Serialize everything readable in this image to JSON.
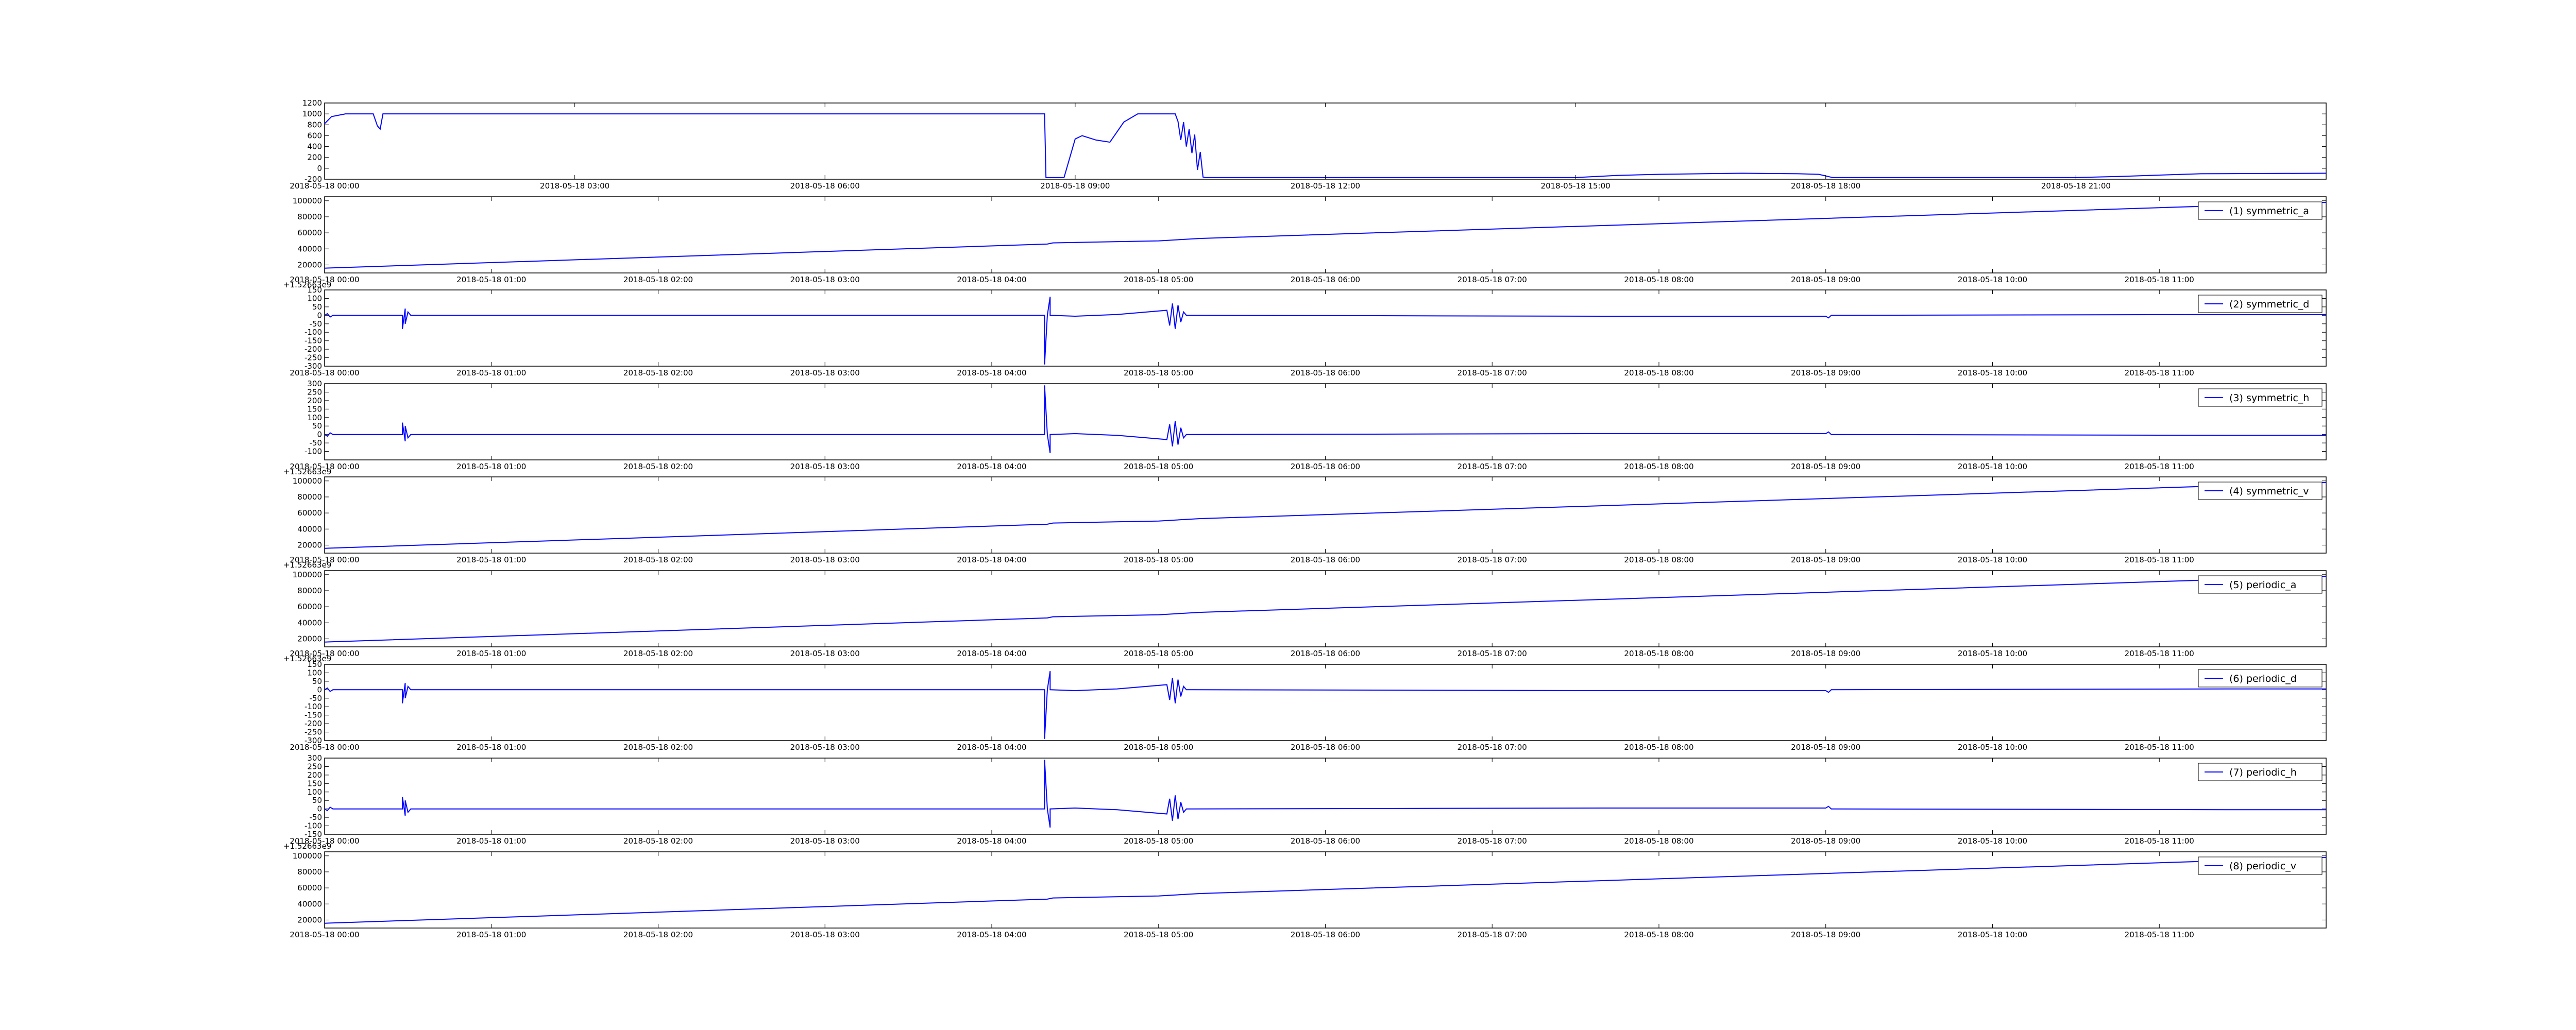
{
  "figure": {
    "line_color": "#0000ff",
    "background": "#ffffff"
  },
  "chart_data": [
    {
      "type": "line",
      "x_range": [
        "2018-05-18 00:00",
        "2018-05-19 00:00"
      ],
      "x_ticks": [
        "2018-05-18 00:00",
        "2018-05-18 03:00",
        "2018-05-18 06:00",
        "2018-05-18 09:00",
        "2018-05-18 12:00",
        "2018-05-18 15:00",
        "2018-05-18 18:00",
        "2018-05-18 21:00"
      ],
      "ylim": [
        -200,
        1200
      ],
      "y_ticks": [
        -200,
        0,
        200,
        400,
        600,
        800,
        1000,
        1200
      ],
      "offset_text": "",
      "legend": "",
      "series": [
        {
          "x": [
            "2018-05-18 00:00",
            "2018-05-18 00:05",
            "2018-05-18 00:15",
            "2018-05-18 00:30",
            "2018-05-18 00:35",
            "2018-05-18 00:38",
            "2018-05-18 00:40",
            "2018-05-18 00:42",
            "2018-05-18 01:00",
            "2018-05-18 04:00",
            "2018-05-18 07:00",
            "2018-05-18 08:38",
            "2018-05-18 08:39",
            "2018-05-18 08:50",
            "2018-05-18 08:52",
            "2018-05-18 09:00",
            "2018-05-18 09:05",
            "2018-05-18 09:15",
            "2018-05-18 09:25",
            "2018-05-18 09:35",
            "2018-05-18 09:45",
            "2018-05-18 10:10",
            "2018-05-18 10:12",
            "2018-05-18 10:14",
            "2018-05-18 10:16",
            "2018-05-18 10:18",
            "2018-05-18 10:20",
            "2018-05-18 10:22",
            "2018-05-18 10:24",
            "2018-05-18 10:26",
            "2018-05-18 10:28",
            "2018-05-18 10:30",
            "2018-05-18 10:32",
            "2018-05-18 10:34",
            "2018-05-18 12:00",
            "2018-05-18 15:00",
            "2018-05-18 15:30",
            "2018-05-18 16:00",
            "2018-05-18 17:00",
            "2018-05-18 17:40",
            "2018-05-18 17:55",
            "2018-05-18 18:05",
            "2018-05-18 18:15",
            "2018-05-18 21:00",
            "2018-05-18 21:30",
            "2018-05-18 22:30",
            "2018-05-19 00:00"
          ],
          "y": [
            820,
            950,
            1000,
            1000,
            1000,
            780,
            720,
            1000,
            1000,
            1000,
            1000,
            1000,
            -170,
            -170,
            -170,
            540,
            600,
            520,
            480,
            850,
            1000,
            1000,
            1000,
            860,
            520,
            850,
            400,
            720,
            280,
            620,
            -30,
            300,
            -160,
            -170,
            -170,
            -170,
            -130,
            -110,
            -90,
            -100,
            -110,
            -170,
            -170,
            -170,
            -150,
            -100,
            -90
          ]
        }
      ]
    },
    {
      "type": "line",
      "x_range": [
        "2018-05-18 00:00",
        "2018-05-18 12:00"
      ],
      "x_ticks": [
        "2018-05-18 00:00",
        "2018-05-18 01:00",
        "2018-05-18 02:00",
        "2018-05-18 03:00",
        "2018-05-18 04:00",
        "2018-05-18 05:00",
        "2018-05-18 06:00",
        "2018-05-18 07:00",
        "2018-05-18 08:00",
        "2018-05-18 09:00",
        "2018-05-18 10:00",
        "2018-05-18 11:00"
      ],
      "ylim": [
        10000,
        105000
      ],
      "y_ticks": [
        20000,
        40000,
        60000,
        80000,
        100000
      ],
      "offset_text": "+1.52663e9",
      "legend": "(1) symmetric_a",
      "series": [
        {
          "x": [
            "2018-05-18 00:00",
            "2018-05-18 04:20",
            "2018-05-18 04:22",
            "2018-05-18 05:00",
            "2018-05-18 05:15",
            "2018-05-18 12:00"
          ],
          "y": [
            16000,
            46000,
            47500,
            50000,
            53000,
            98000
          ]
        }
      ]
    },
    {
      "type": "line",
      "x_range": [
        "2018-05-18 00:00",
        "2018-05-18 12:00"
      ],
      "x_ticks": [
        "2018-05-18 00:00",
        "2018-05-18 01:00",
        "2018-05-18 02:00",
        "2018-05-18 03:00",
        "2018-05-18 04:00",
        "2018-05-18 05:00",
        "2018-05-18 06:00",
        "2018-05-18 07:00",
        "2018-05-18 08:00",
        "2018-05-18 09:00",
        "2018-05-18 10:00",
        "2018-05-18 11:00"
      ],
      "ylim": [
        -300,
        150
      ],
      "y_ticks": [
        -300,
        -250,
        -200,
        -150,
        -100,
        -50,
        0,
        50,
        100,
        150
      ],
      "offset_text": "",
      "legend": "(2) symmetric_d",
      "series": [
        {
          "x": [
            "2018-05-18 00:00",
            "2018-05-18 00:01",
            "2018-05-18 00:02",
            "2018-05-18 00:03",
            "2018-05-18 00:28",
            "2018-05-18 00:28",
            "2018-05-18 00:29",
            "2018-05-18 00:29",
            "2018-05-18 00:30",
            "2018-05-18 00:31",
            "2018-05-18 04:19",
            "2018-05-18 04:19",
            "2018-05-18 04:20",
            "2018-05-18 04:21",
            "2018-05-18 04:21",
            "2018-05-18 04:30",
            "2018-05-18 04:45",
            "2018-05-18 05:03",
            "2018-05-18 05:04",
            "2018-05-18 05:05",
            "2018-05-18 05:06",
            "2018-05-18 05:07",
            "2018-05-18 05:08",
            "2018-05-18 05:09",
            "2018-05-18 05:10",
            "2018-05-18 05:12",
            "2018-05-18 07:40",
            "2018-05-18 09:00",
            "2018-05-18 09:01",
            "2018-05-18 09:02",
            "2018-05-18 11:30",
            "2018-05-18 12:00"
          ],
          "y": [
            0,
            10,
            -10,
            0,
            0,
            -80,
            40,
            -50,
            20,
            0,
            0,
            -290,
            0,
            110,
            0,
            -5,
            5,
            30,
            -60,
            70,
            -80,
            60,
            -40,
            20,
            0,
            0,
            -5,
            -5,
            -15,
            0,
            5,
            5
          ]
        }
      ]
    },
    {
      "type": "line",
      "x_range": [
        "2018-05-18 00:00",
        "2018-05-18 12:00"
      ],
      "x_ticks": [
        "2018-05-18 00:00",
        "2018-05-18 01:00",
        "2018-05-18 02:00",
        "2018-05-18 03:00",
        "2018-05-18 04:00",
        "2018-05-18 05:00",
        "2018-05-18 06:00",
        "2018-05-18 07:00",
        "2018-05-18 08:00",
        "2018-05-18 09:00",
        "2018-05-18 10:00",
        "2018-05-18 11:00"
      ],
      "ylim": [
        -150,
        300
      ],
      "y_ticks": [
        -100,
        -50,
        0,
        50,
        100,
        150,
        200,
        250,
        300
      ],
      "offset_text": "+1.52663e9",
      "legend": "(3) symmetric_h",
      "series": [
        {
          "x": [
            "2018-05-18 00:00",
            "2018-05-18 00:01",
            "2018-05-18 00:02",
            "2018-05-18 00:03",
            "2018-05-18 00:28",
            "2018-05-18 00:28",
            "2018-05-18 00:29",
            "2018-05-18 00:29",
            "2018-05-18 00:30",
            "2018-05-18 00:31",
            "2018-05-18 04:19",
            "2018-05-18 04:19",
            "2018-05-18 04:20",
            "2018-05-18 04:21",
            "2018-05-18 04:21",
            "2018-05-18 04:30",
            "2018-05-18 04:45",
            "2018-05-18 05:03",
            "2018-05-18 05:04",
            "2018-05-18 05:05",
            "2018-05-18 05:06",
            "2018-05-18 05:07",
            "2018-05-18 05:08",
            "2018-05-18 05:09",
            "2018-05-18 05:10",
            "2018-05-18 05:12",
            "2018-05-18 07:40",
            "2018-05-18 09:00",
            "2018-05-18 09:01",
            "2018-05-18 09:02",
            "2018-05-18 11:30",
            "2018-05-18 12:00"
          ],
          "y": [
            0,
            -10,
            10,
            0,
            0,
            70,
            -40,
            50,
            -20,
            0,
            0,
            290,
            0,
            -110,
            0,
            5,
            -5,
            -30,
            60,
            -70,
            80,
            -60,
            40,
            -20,
            0,
            0,
            5,
            5,
            15,
            0,
            -5,
            -5
          ]
        }
      ]
    },
    {
      "type": "line",
      "x_range": [
        "2018-05-18 00:00",
        "2018-05-18 12:00"
      ],
      "x_ticks": [
        "2018-05-18 00:00",
        "2018-05-18 01:00",
        "2018-05-18 02:00",
        "2018-05-18 03:00",
        "2018-05-18 04:00",
        "2018-05-18 05:00",
        "2018-05-18 06:00",
        "2018-05-18 07:00",
        "2018-05-18 08:00",
        "2018-05-18 09:00",
        "2018-05-18 10:00",
        "2018-05-18 11:00"
      ],
      "ylim": [
        10000,
        105000
      ],
      "y_ticks": [
        20000,
        40000,
        60000,
        80000,
        100000
      ],
      "offset_text": "+1.52663e9",
      "legend": "(4) symmetric_v",
      "series": [
        {
          "x": [
            "2018-05-18 00:00",
            "2018-05-18 04:20",
            "2018-05-18 04:22",
            "2018-05-18 05:00",
            "2018-05-18 05:15",
            "2018-05-18 12:00"
          ],
          "y": [
            16000,
            46000,
            47500,
            50000,
            53000,
            98000
          ]
        }
      ]
    },
    {
      "type": "line",
      "x_range": [
        "2018-05-18 00:00",
        "2018-05-18 12:00"
      ],
      "x_ticks": [
        "2018-05-18 00:00",
        "2018-05-18 01:00",
        "2018-05-18 02:00",
        "2018-05-18 03:00",
        "2018-05-18 04:00",
        "2018-05-18 05:00",
        "2018-05-18 06:00",
        "2018-05-18 07:00",
        "2018-05-18 08:00",
        "2018-05-18 09:00",
        "2018-05-18 10:00",
        "2018-05-18 11:00"
      ],
      "ylim": [
        10000,
        105000
      ],
      "y_ticks": [
        20000,
        40000,
        60000,
        80000,
        100000
      ],
      "offset_text": "+1.52663e9",
      "legend": "(5) periodic_a",
      "series": [
        {
          "x": [
            "2018-05-18 00:00",
            "2018-05-18 04:20",
            "2018-05-18 04:22",
            "2018-05-18 05:00",
            "2018-05-18 05:15",
            "2018-05-18 12:00"
          ],
          "y": [
            16000,
            46000,
            47500,
            50000,
            53000,
            98000
          ]
        }
      ]
    },
    {
      "type": "line",
      "x_range": [
        "2018-05-18 00:00",
        "2018-05-18 12:00"
      ],
      "x_ticks": [
        "2018-05-18 00:00",
        "2018-05-18 01:00",
        "2018-05-18 02:00",
        "2018-05-18 03:00",
        "2018-05-18 04:00",
        "2018-05-18 05:00",
        "2018-05-18 06:00",
        "2018-05-18 07:00",
        "2018-05-18 08:00",
        "2018-05-18 09:00",
        "2018-05-18 10:00",
        "2018-05-18 11:00"
      ],
      "ylim": [
        -300,
        150
      ],
      "y_ticks": [
        -300,
        -250,
        -200,
        -150,
        -100,
        -50,
        0,
        50,
        100,
        150
      ],
      "offset_text": "",
      "legend": "(6) periodic_d",
      "series": [
        {
          "x": [
            "2018-05-18 00:00",
            "2018-05-18 00:01",
            "2018-05-18 00:02",
            "2018-05-18 00:03",
            "2018-05-18 00:28",
            "2018-05-18 00:28",
            "2018-05-18 00:29",
            "2018-05-18 00:29",
            "2018-05-18 00:30",
            "2018-05-18 00:31",
            "2018-05-18 04:19",
            "2018-05-18 04:19",
            "2018-05-18 04:20",
            "2018-05-18 04:21",
            "2018-05-18 04:21",
            "2018-05-18 04:30",
            "2018-05-18 04:45",
            "2018-05-18 05:03",
            "2018-05-18 05:04",
            "2018-05-18 05:05",
            "2018-05-18 05:06",
            "2018-05-18 05:07",
            "2018-05-18 05:08",
            "2018-05-18 05:09",
            "2018-05-18 05:10",
            "2018-05-18 05:12",
            "2018-05-18 07:40",
            "2018-05-18 09:00",
            "2018-05-18 09:01",
            "2018-05-18 09:02",
            "2018-05-18 11:30",
            "2018-05-18 12:00"
          ],
          "y": [
            0,
            10,
            -10,
            0,
            0,
            -80,
            40,
            -50,
            20,
            0,
            0,
            -290,
            0,
            110,
            0,
            -5,
            5,
            30,
            -60,
            70,
            -80,
            60,
            -40,
            20,
            0,
            0,
            -5,
            -5,
            -15,
            0,
            5,
            5
          ]
        }
      ]
    },
    {
      "type": "line",
      "x_range": [
        "2018-05-18 00:00",
        "2018-05-18 12:00"
      ],
      "x_ticks": [
        "2018-05-18 00:00",
        "2018-05-18 01:00",
        "2018-05-18 02:00",
        "2018-05-18 03:00",
        "2018-05-18 04:00",
        "2018-05-18 05:00",
        "2018-05-18 06:00",
        "2018-05-18 07:00",
        "2018-05-18 08:00",
        "2018-05-18 09:00",
        "2018-05-18 10:00",
        "2018-05-18 11:00"
      ],
      "ylim": [
        -150,
        300
      ],
      "y_ticks": [
        -150,
        -100,
        -50,
        0,
        50,
        100,
        150,
        200,
        250,
        300
      ],
      "offset_text": "+1.52663e9",
      "legend": "(7) periodic_h",
      "series": [
        {
          "x": [
            "2018-05-18 00:00",
            "2018-05-18 00:01",
            "2018-05-18 00:02",
            "2018-05-18 00:03",
            "2018-05-18 00:28",
            "2018-05-18 00:28",
            "2018-05-18 00:29",
            "2018-05-18 00:29",
            "2018-05-18 00:30",
            "2018-05-18 00:31",
            "2018-05-18 04:19",
            "2018-05-18 04:19",
            "2018-05-18 04:20",
            "2018-05-18 04:21",
            "2018-05-18 04:21",
            "2018-05-18 04:30",
            "2018-05-18 04:45",
            "2018-05-18 05:03",
            "2018-05-18 05:04",
            "2018-05-18 05:05",
            "2018-05-18 05:06",
            "2018-05-18 05:07",
            "2018-05-18 05:08",
            "2018-05-18 05:09",
            "2018-05-18 05:10",
            "2018-05-18 05:12",
            "2018-05-18 07:40",
            "2018-05-18 09:00",
            "2018-05-18 09:01",
            "2018-05-18 09:02",
            "2018-05-18 11:30",
            "2018-05-18 12:00"
          ],
          "y": [
            0,
            -10,
            10,
            0,
            0,
            70,
            -40,
            50,
            -20,
            0,
            0,
            290,
            0,
            -110,
            0,
            5,
            -5,
            -30,
            60,
            -70,
            80,
            -60,
            40,
            -20,
            0,
            0,
            5,
            5,
            15,
            0,
            -5,
            -5
          ]
        }
      ]
    },
    {
      "type": "line",
      "x_range": [
        "2018-05-18 00:00",
        "2018-05-18 12:00"
      ],
      "x_ticks": [
        "2018-05-18 00:00",
        "2018-05-18 01:00",
        "2018-05-18 02:00",
        "2018-05-18 03:00",
        "2018-05-18 04:00",
        "2018-05-18 05:00",
        "2018-05-18 06:00",
        "2018-05-18 07:00",
        "2018-05-18 08:00",
        "2018-05-18 09:00",
        "2018-05-18 10:00",
        "2018-05-18 11:00"
      ],
      "ylim": [
        10000,
        105000
      ],
      "y_ticks": [
        20000,
        40000,
        60000,
        80000,
        100000
      ],
      "offset_text": "",
      "legend": "(8) periodic_v",
      "series": [
        {
          "x": [
            "2018-05-18 00:00",
            "2018-05-18 04:20",
            "2018-05-18 04:22",
            "2018-05-18 05:00",
            "2018-05-18 05:15",
            "2018-05-18 12:00"
          ],
          "y": [
            16000,
            46000,
            47500,
            50000,
            53000,
            98000
          ]
        }
      ]
    }
  ]
}
